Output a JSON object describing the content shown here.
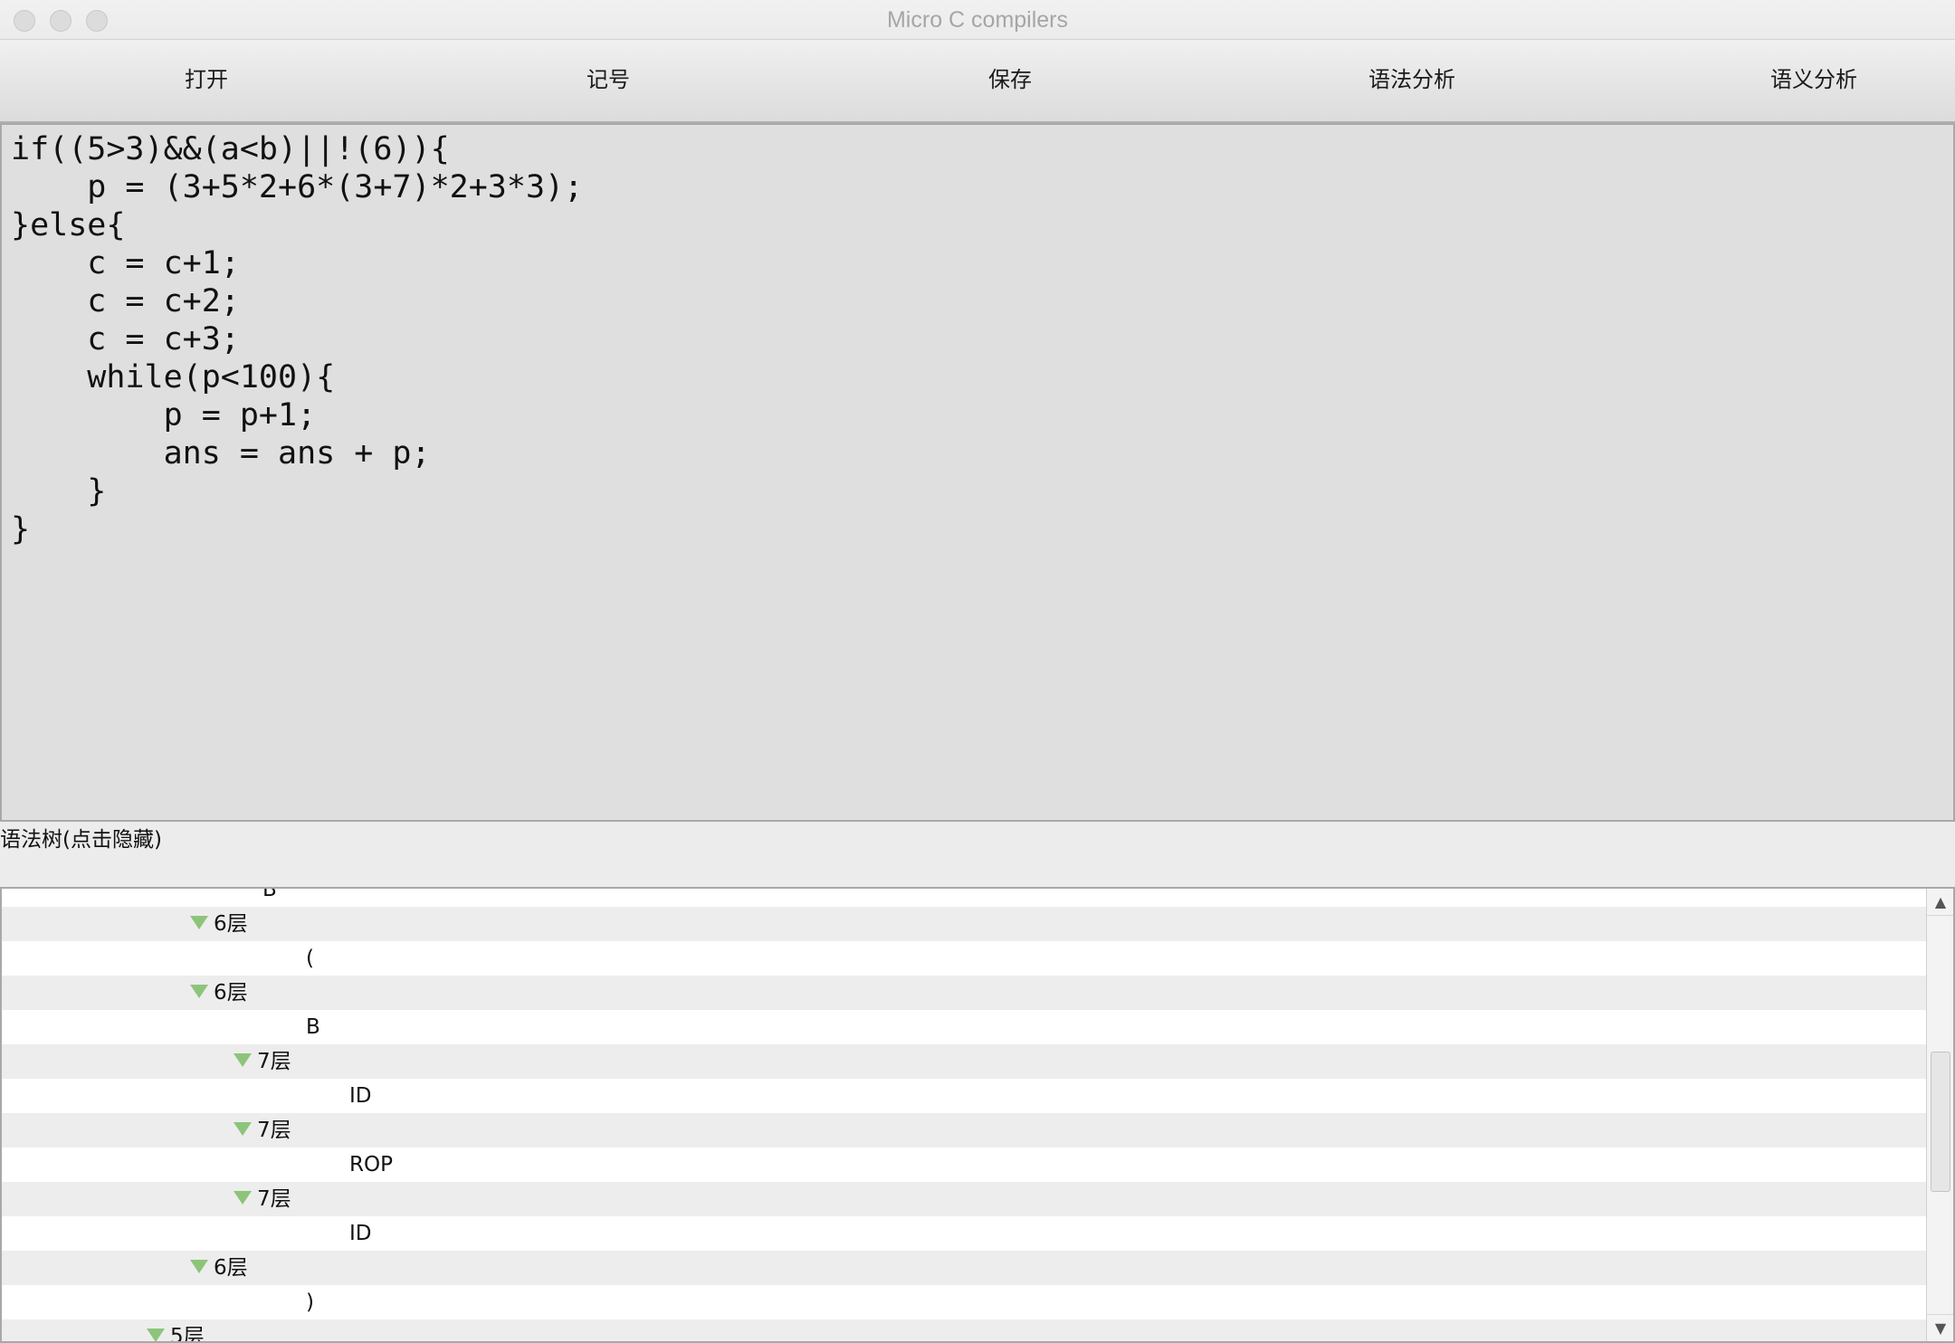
{
  "window": {
    "title": "Micro C compilers"
  },
  "toolbar": {
    "open": "打开",
    "tokens": "记号",
    "save": "保存",
    "syntax_analysis": "语法分析",
    "semantic_analysis": "语义分析"
  },
  "editor": {
    "code": "if((5>3)&&(a<b)||!(6)){\n    p = (3+5*2+6*(3+7)*2+3*3);\n}else{\n    c = c+1;\n    c = c+2;\n    c = c+3;\n    while(p<100){\n        p = p+1;\n        ans = ans + p;\n    }\n}"
  },
  "tree_panel": {
    "label": "语法树(点击隐藏)",
    "rows": [
      {
        "text": "B",
        "level": 5,
        "expander": false
      },
      {
        "text": "6层",
        "level": 4,
        "expander": true
      },
      {
        "text": "(",
        "level": 6,
        "expander": false
      },
      {
        "text": "6层",
        "level": 4,
        "expander": true
      },
      {
        "text": "B",
        "level": 6,
        "expander": false
      },
      {
        "text": "7层",
        "level": 5,
        "expander": true
      },
      {
        "text": "ID",
        "level": 7,
        "expander": false
      },
      {
        "text": "7层",
        "level": 5,
        "expander": true
      },
      {
        "text": "ROP",
        "level": 7,
        "expander": false
      },
      {
        "text": "7层",
        "level": 5,
        "expander": true
      },
      {
        "text": "ID",
        "level": 7,
        "expander": false
      },
      {
        "text": "6层",
        "level": 4,
        "expander": true
      },
      {
        "text": ")",
        "level": 6,
        "expander": false
      },
      {
        "text": "5层",
        "level": 3,
        "expander": true
      }
    ]
  },
  "colors": {
    "expander_arrow": "#8cc57a",
    "editor_bg": "#dfdfdf",
    "row_alt": "#ededed"
  },
  "icons": {
    "expander": "triangle-down-icon",
    "scroll_up": "scroll-up-arrow-icon",
    "scroll_down": "scroll-down-arrow-icon"
  }
}
